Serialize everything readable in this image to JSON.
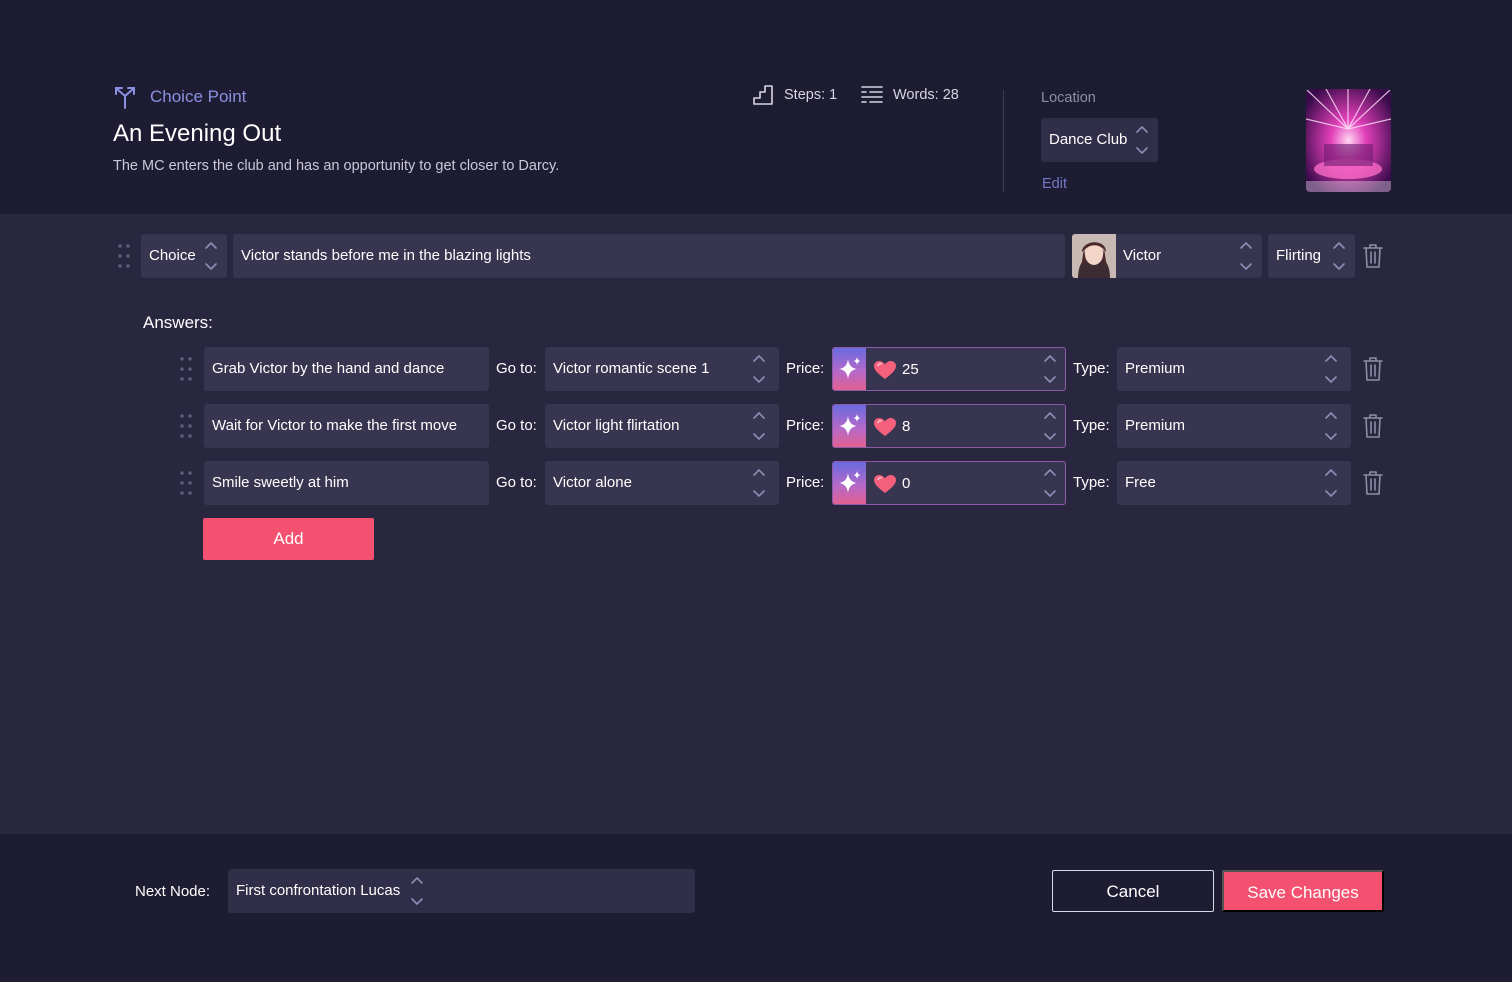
{
  "header": {
    "badge_label": "Choice Point",
    "title": "An Evening Out",
    "description": "The MC enters the club and has an opportunity to get closer to Darcy.",
    "steps_label": "Steps: 1",
    "words_label": "Words: 28",
    "location_label": "Location",
    "location_value": "Dance Club",
    "edit_label": "Edit"
  },
  "node": {
    "type": "Choice",
    "text": "Victor stands before me in the blazing lights",
    "character": "Victor",
    "emotion": "Flirting"
  },
  "answers_label": "Answers:",
  "answer_labels": {
    "goto": "Go to:",
    "price": "Price:",
    "type": "Type:"
  },
  "answers": [
    {
      "text": "Grab Victor by the hand and dance",
      "goto": "Victor romantic scene 1",
      "price": "25",
      "type": "Premium"
    },
    {
      "text": "Wait for Victor to make the first move",
      "goto": "Victor light flirtation",
      "price": "8",
      "type": "Premium"
    },
    {
      "text": "Smile sweetly at him",
      "goto": "Victor alone",
      "price": "0",
      "type": "Free"
    }
  ],
  "add_label": "Add",
  "footer": {
    "next_node_label": "Next Node:",
    "next_node_value": "First confrontation Lucas",
    "cancel_label": "Cancel",
    "save_label": "Save Changes"
  },
  "colors": {
    "background": "#1e1c32",
    "panel": "#29273f",
    "field": "#37354f",
    "accent": "#f4506f",
    "link": "#7478c9"
  }
}
